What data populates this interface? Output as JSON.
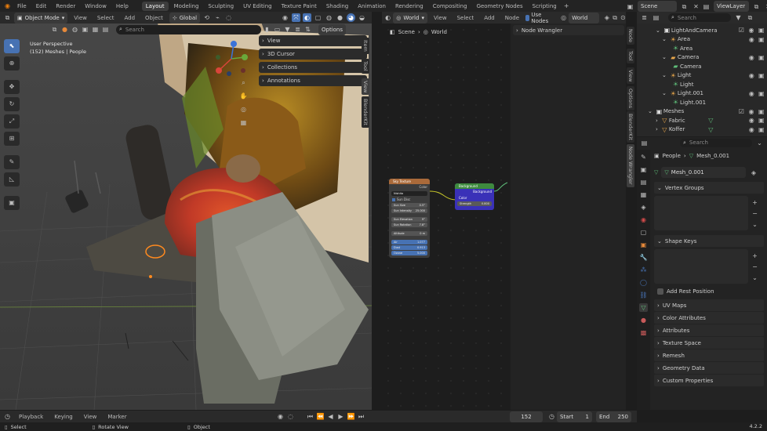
{
  "menus": [
    "File",
    "Edit",
    "Render",
    "Window",
    "Help"
  ],
  "workspaces": [
    "Layout",
    "Modeling",
    "Sculpting",
    "UV Editing",
    "Texture Paint",
    "Shading",
    "Animation",
    "Rendering",
    "Compositing",
    "Geometry Nodes",
    "Scripting"
  ],
  "active_workspace": "Layout",
  "scene": {
    "label": "Scene",
    "viewlayer": "ViewLayer"
  },
  "viewport": {
    "mode": "Object Mode",
    "menus": [
      "View",
      "Select",
      "Add",
      "Object"
    ],
    "orientation": "Global",
    "search_placeholder": "Search",
    "options": "Options",
    "overlay_text": [
      "User Perspective",
      "(152) Meshes | People"
    ],
    "panels": [
      "View",
      "3D Cursor",
      "Collections",
      "Annotations"
    ],
    "side_tabs": [
      "Item",
      "Tool",
      "View",
      "BlenderKit"
    ]
  },
  "node_editor": {
    "world_label": "World",
    "menus": [
      "View",
      "Select",
      "Add",
      "Node"
    ],
    "use_nodes": "Use Nodes",
    "world_name": "World",
    "breadcrumb": [
      "Scene",
      "World"
    ],
    "panel": "Node Wrangler",
    "side_tabs": [
      "Node",
      "Tool",
      "View",
      "Options",
      "BlenderKit",
      "Node Wrangler"
    ],
    "sky_node": {
      "title": "Sky Texture",
      "output": "Color",
      "type": "Nishita",
      "sun_disc": "Sun Disc",
      "fields": [
        [
          "Sun Size",
          "0.5°"
        ],
        [
          "Sun Intensity",
          "25.000"
        ],
        [
          "Sun Elevation",
          "9°"
        ],
        [
          "Sun Rotation",
          "7.8°"
        ],
        [
          "Altitude",
          "0 m"
        ],
        [
          "Air",
          "1.077"
        ],
        [
          "Dust",
          "0.913"
        ],
        [
          "Ozone",
          "5.000"
        ]
      ]
    },
    "bg_node": {
      "title": "Background",
      "output": "Background",
      "color": "Color",
      "strength_label": "Strength",
      "strength": "0.800"
    }
  },
  "outliner": {
    "search_placeholder": "Search",
    "items": [
      {
        "label": "LightAndCamera",
        "indent": 0
      },
      {
        "label": "Area",
        "indent": 1
      },
      {
        "label": "Area",
        "indent": 2
      },
      {
        "label": "Camera",
        "indent": 1
      },
      {
        "label": "Camera",
        "indent": 2
      },
      {
        "label": "Light",
        "indent": 1
      },
      {
        "label": "Light",
        "indent": 2
      },
      {
        "label": "Light.001",
        "indent": 1
      },
      {
        "label": "Light.001",
        "indent": 2
      },
      {
        "label": "Meshes",
        "indent": 0
      },
      {
        "label": "Fabric",
        "indent": 1
      },
      {
        "label": "Koffer",
        "indent": 1
      }
    ]
  },
  "properties": {
    "search_placeholder": "Search",
    "breadcrumb": [
      "People",
      "Mesh_0.001"
    ],
    "mesh_name": "Mesh_0.001",
    "vertex_groups": "Vertex Groups",
    "shape_keys": "Shape Keys",
    "add_rest_position": "Add Rest Position",
    "sections": [
      "UV Maps",
      "Color Attributes",
      "Attributes",
      "Texture Space",
      "Remesh",
      "Geometry Data",
      "Custom Properties"
    ]
  },
  "timeline": {
    "menus": [
      "Playback",
      "Keying",
      "View",
      "Marker"
    ],
    "frame": "152",
    "start_label": "Start",
    "start": "1",
    "end_label": "End",
    "end": "250"
  },
  "statusbar": {
    "items": [
      "Select",
      "Rotate View",
      "Object"
    ],
    "version": "4.2.2"
  },
  "colors": {
    "accent": "#4772b3",
    "sky_node_header": "#aa6a3a",
    "bg_node_header": "#3e8a3e",
    "bg_node_body": "#3a31b8",
    "green_icon": "#5fbf7a"
  }
}
